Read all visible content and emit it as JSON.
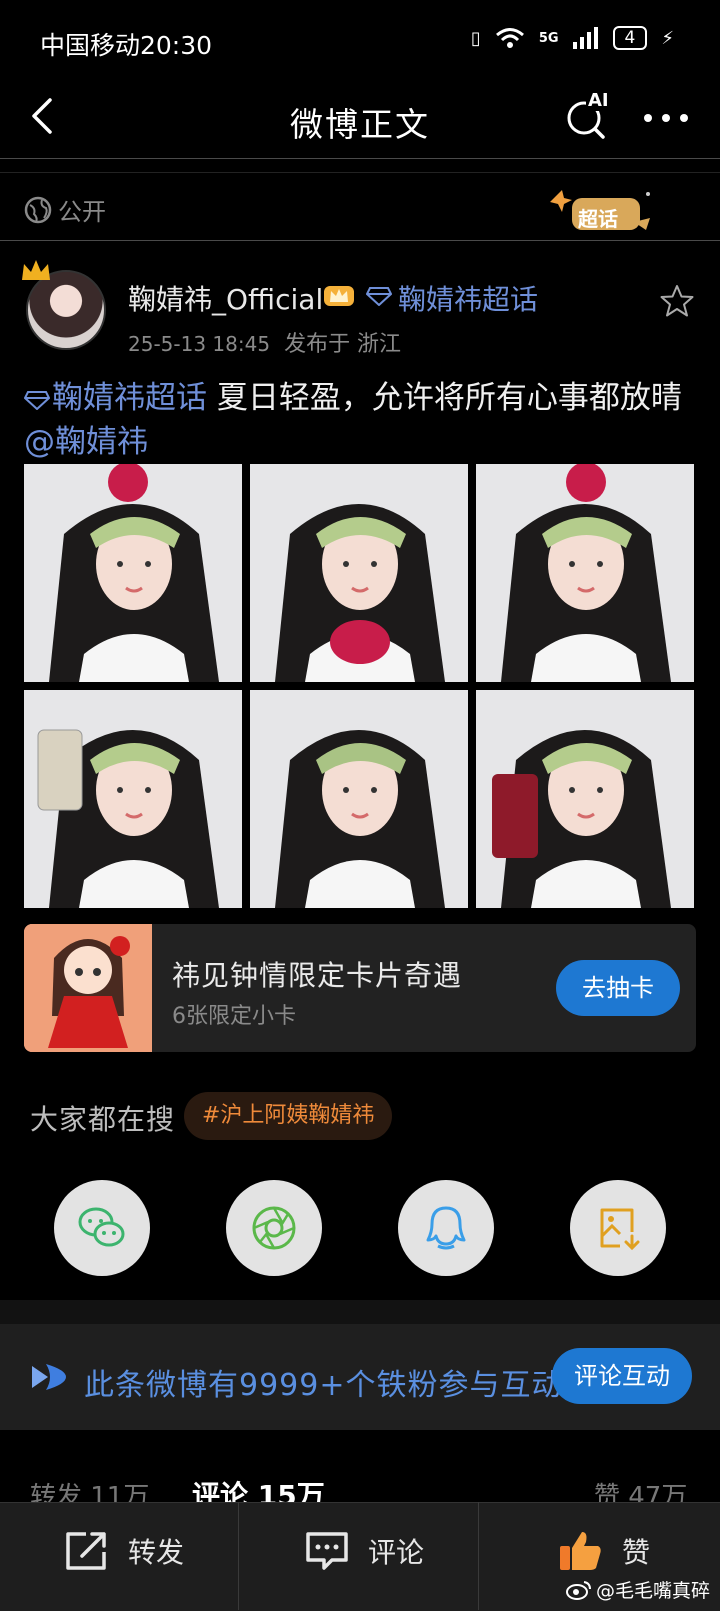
{
  "status_bar": {
    "carrier_time": "中国移动20:30",
    "network": "5G",
    "battery": "4"
  },
  "nav": {
    "title": "微博正文",
    "ai_label": "AI"
  },
  "visibility": {
    "label": "公开",
    "badge": "超话"
  },
  "post": {
    "username": "鞠婧祎_Official",
    "supertopic": "鞠婧祎超话",
    "time": "25-5-13 18:45",
    "location": "发布于 浙江",
    "content_topic": "鞠婧祎超话",
    "content_text": " 夏日轻盈，允许将所有心事都放晴",
    "content_mention": "@鞠婧祎"
  },
  "photos": [
    "photo-1",
    "photo-2",
    "photo-3",
    "photo-4",
    "photo-5",
    "photo-6"
  ],
  "promo": {
    "title": "祎见钟情限定卡片奇遇",
    "subtitle": "6张限定小卡",
    "button": "去抽卡"
  },
  "hot_search": {
    "label": "大家都在搜",
    "tag": "#沪上阿姨鞠婧祎"
  },
  "share": [
    "wechat-icon",
    "moments-icon",
    "qq-icon",
    "save-image-icon"
  ],
  "interaction": {
    "text": "此条微博有9999+个铁粉参与互动",
    "button": "评论互动"
  },
  "counts": {
    "repost": "转发 11万",
    "comment": "评论 15万",
    "like": "赞 47万"
  },
  "bottom_bar": {
    "repost": "转发",
    "comment": "评论",
    "like": "赞"
  },
  "watermark": "@毛毛嘴真碎",
  "colors": {
    "accent_blue": "#1e78d2",
    "link_blue": "#6f8fd8",
    "hot_orange": "#ef8a3a"
  }
}
